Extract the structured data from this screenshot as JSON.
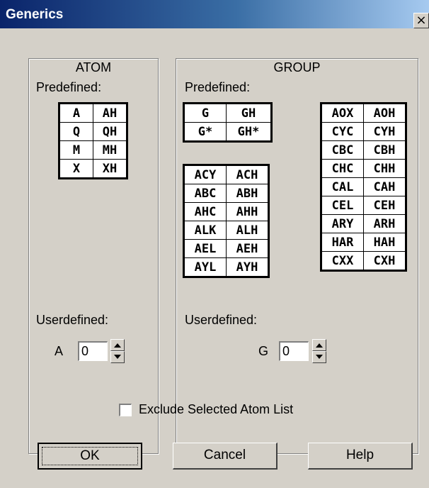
{
  "window": {
    "title": "Generics",
    "close_glyph": "×"
  },
  "atom": {
    "title": "ATOM",
    "predefined_label": "Predefined:",
    "table": [
      [
        "A",
        "AH"
      ],
      [
        "Q",
        "QH"
      ],
      [
        "M",
        "MH"
      ],
      [
        "X",
        "XH"
      ]
    ],
    "userdefined_label": "Userdefined:",
    "spin_prefix": "A",
    "spin_value": "0"
  },
  "group": {
    "title": "GROUP",
    "predefined_label": "Predefined:",
    "table_small": [
      [
        "G",
        "GH"
      ],
      [
        "G*",
        "GH*"
      ]
    ],
    "table_left": [
      [
        "ACY",
        "ACH"
      ],
      [
        "ABC",
        "ABH"
      ],
      [
        "AHC",
        "AHH"
      ],
      [
        "ALK",
        "ALH"
      ],
      [
        "AEL",
        "AEH"
      ],
      [
        "AYL",
        "AYH"
      ]
    ],
    "table_right": [
      [
        "AOX",
        "AOH"
      ],
      [
        "CYC",
        "CYH"
      ],
      [
        "CBC",
        "CBH"
      ],
      [
        "CHC",
        "CHH"
      ],
      [
        "CAL",
        "CAH"
      ],
      [
        "CEL",
        "CEH"
      ],
      [
        "ARY",
        "ARH"
      ],
      [
        "HAR",
        "HAH"
      ],
      [
        "CXX",
        "CXH"
      ]
    ],
    "userdefined_label": "Userdefined:",
    "spin_prefix": "G",
    "spin_value": "0"
  },
  "exclude_checkbox": {
    "label": "Exclude Selected Atom List",
    "checked": false
  },
  "buttons": {
    "ok": "OK",
    "cancel": "Cancel",
    "help": "Help"
  },
  "icons": {
    "close": "close-icon",
    "spin_up": "chevron-up-icon",
    "spin_down": "chevron-down-icon"
  }
}
